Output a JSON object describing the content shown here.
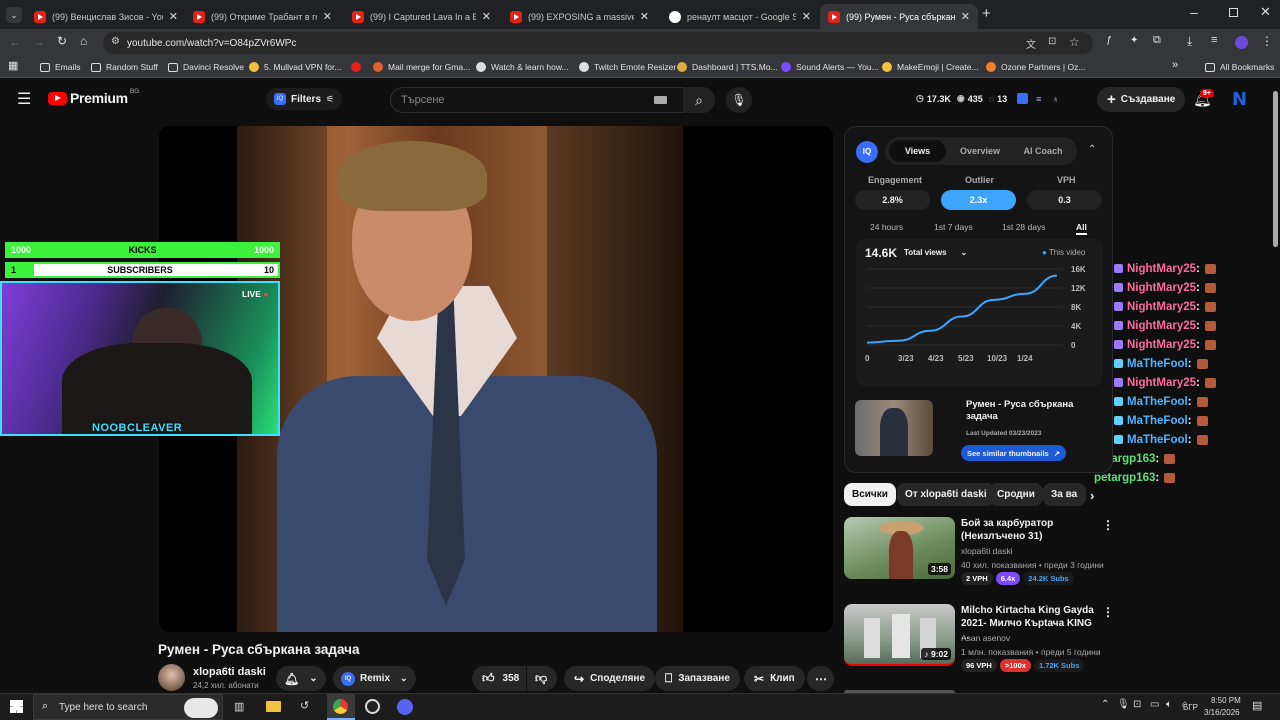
{
  "tabs": [
    {
      "label": "(99) Венцислав Зисов - YouTube",
      "icon": "youtube-icon"
    },
    {
      "label": "(99) Откриме Трабант в гората",
      "icon": "youtube-icon"
    },
    {
      "label": "(99) I Captured Lava In a Bucket",
      "icon": "youtube-icon"
    },
    {
      "label": "(99) EXPOSING a massive eBay",
      "icon": "youtube-icon"
    },
    {
      "label": "ренаулт масцот - Google Search",
      "icon": "google-icon"
    },
    {
      "label": "(99) Румен - Руса сбъркана задача",
      "icon": "youtube-icon"
    }
  ],
  "browser": {
    "url": "youtube.com/watch?v=O84pZVr6WPc",
    "new_tab": "+"
  },
  "bookmarks": [
    {
      "label": "Emails",
      "icon": "folder-icon"
    },
    {
      "label": "Random Stuff",
      "icon": "folder-icon"
    },
    {
      "label": "Davinci Resolve",
      "icon": "folder-icon"
    },
    {
      "label": "5. Mullvad VPN for...",
      "icon": "mullvad-icon"
    },
    {
      "label": "",
      "icon": "youtube-icon"
    },
    {
      "label": "Mail merge for Gma...",
      "icon": "mailmerge-icon"
    },
    {
      "label": "Watch & learn how...",
      "icon": "camera-icon"
    },
    {
      "label": "Twitch Emote Resizer",
      "icon": "globe-icon"
    },
    {
      "label": "Dashboard | TTS.Mo...",
      "icon": "tts-icon"
    },
    {
      "label": "Sound Alerts — You...",
      "icon": "soundalerts-icon"
    },
    {
      "label": "MakeEmoji | Create...",
      "icon": "emoji-icon"
    },
    {
      "label": "Ozone Partners | Oz...",
      "icon": "ozone-icon"
    }
  ],
  "all_bookmarks": "All Bookmarks",
  "yt": {
    "logo": "Premium",
    "region": "BG",
    "filters": "Filters",
    "search_placeholder": "Търсене",
    "stats": {
      "views": "17.3K",
      "eye": "435",
      "count": "13"
    },
    "create": "Създаване",
    "notif_badge": "9+",
    "avatar": "N"
  },
  "overlay": {
    "kicks_label": "KICKS",
    "kicks_left": "1000",
    "kicks_right": "1000",
    "kicks_progress": 1.0,
    "subs_label": "SUBSCRIBERS",
    "subs_left": "1",
    "subs_right": "10",
    "subs_progress": 0.1,
    "live": "LIVE",
    "streamer": "NOOBCLEAVER"
  },
  "chat": [
    {
      "user": "NightMary25",
      "color": "#ff6a9e",
      "badges": [
        "#3fa9f5",
        "#f5b63f",
        "#9a7bff"
      ]
    },
    {
      "user": "NightMary25",
      "color": "#ff6a9e",
      "badges": [
        "#3fa9f5",
        "#f5b63f",
        "#9a7bff"
      ]
    },
    {
      "user": "NightMary25",
      "color": "#ff6a9e",
      "badges": [
        "#3fa9f5",
        "#f5b63f",
        "#9a7bff"
      ]
    },
    {
      "user": "NightMary25",
      "color": "#ff6a9e",
      "badges": [
        "#3fa9f5",
        "#f5b63f",
        "#9a7bff"
      ]
    },
    {
      "user": "NightMary25",
      "color": "#ff6a9e",
      "badges": [
        "#3fa9f5",
        "#f5b63f",
        "#9a7bff"
      ]
    },
    {
      "user": "MaTheFool",
      "color": "#4fb4ff",
      "badges": [
        "#3fa9f5",
        "#cfe6ff",
        "#5fd0ff"
      ]
    },
    {
      "user": "NightMary25",
      "color": "#ff6a9e",
      "badges": [
        "#3fa9f5",
        "#f5b63f",
        "#9a7bff"
      ]
    },
    {
      "user": "MaTheFool",
      "color": "#4fb4ff",
      "badges": [
        "#3fa9f5",
        "#cfe6ff",
        "#5fd0ff"
      ]
    },
    {
      "user": "MaTheFool",
      "color": "#4fb4ff",
      "badges": [
        "#3fa9f5",
        "#cfe6ff",
        "#5fd0ff"
      ]
    },
    {
      "user": "MaTheFool",
      "color": "#4fb4ff",
      "badges": [
        "#3fa9f5",
        "#cfe6ff",
        "#5fd0ff"
      ]
    },
    {
      "user": "petargp163",
      "color": "#5ee07a",
      "badges": []
    },
    {
      "user": "petargp163",
      "color": "#5ee07a",
      "badges": []
    }
  ],
  "chat_sep": " :",
  "iq": {
    "logo": "IQ",
    "tabs": [
      "Views",
      "Overview",
      "AI Coach"
    ],
    "metrics": [
      {
        "label": "Engagement",
        "value": "2.8%"
      },
      {
        "label": "Outlier",
        "value": "2.3x"
      },
      {
        "label": "VPH",
        "value": "0.3"
      }
    ],
    "ranges": [
      "24 hours",
      "1st 7 days",
      "1st 28 days",
      "All"
    ],
    "total": "14.6K",
    "total_label": "Total views",
    "legend": "This video",
    "video_title": "Румен - Руса сбъркана задача",
    "updated": "Last Updated 03/23/2023",
    "similar_btn": "See similar thumbnails"
  },
  "chart_data": {
    "type": "line",
    "x": [
      "0",
      "3/23",
      "4/23",
      "5/23",
      "10/23",
      "1/24"
    ],
    "yticks": [
      "16K",
      "12K",
      "8K",
      "4K",
      "0"
    ],
    "ylim": [
      0,
      16000
    ],
    "series": [
      {
        "name": "This video",
        "values": [
          500,
          900,
          3000,
          6000,
          9500,
          10800,
          14600
        ]
      }
    ],
    "color": "#3ea6ff"
  },
  "chips": [
    "Всички",
    "От xlopa6ti daski",
    "Сродни",
    "За ва"
  ],
  "recs": [
    {
      "title": "Бой за карбуратор (Неизлъчено 31)",
      "channel": "xlopa6ti daski",
      "meta": "40 хил. показвания • преди 3 години",
      "duration": "3:58",
      "tags": [
        {
          "t": "2 VPH",
          "bg": "#222",
          "fg": "#fff"
        },
        {
          "t": "6.4x",
          "bg": "#7b4bff",
          "fg": "#fff"
        },
        {
          "t": "24.2K Subs",
          "bg": "#1a1a1a",
          "fg": "#3ea6ff"
        }
      ]
    },
    {
      "title": "Milcho Kirtacha King Gayda 2021- Милчо Кърtача KING ...",
      "channel": "Asan asenov",
      "meta": "1 млн. показвания • преди 5 години",
      "duration": "9:02",
      "tags": [
        {
          "t": "96 VPH",
          "bg": "#222",
          "fg": "#fff"
        },
        {
          "t": ">100x",
          "bg": "#e03030",
          "fg": "#fff"
        },
        {
          "t": "1.72K Subs",
          "bg": "#1a1a1a",
          "fg": "#3ea6ff"
        }
      ]
    }
  ],
  "video": {
    "title": "Румен - Руса сбъркана задача",
    "channel": "xlopa6ti daski",
    "subs": "24,2 хил. абонати",
    "remix": "Remix",
    "likes": "358",
    "share": "Споделяне",
    "save": "Запазване",
    "clip": "Клип"
  },
  "taskbar": {
    "search": "Type here to search",
    "lang": "БГР",
    "time": "8:50 PM",
    "date": "3/16/2026"
  }
}
